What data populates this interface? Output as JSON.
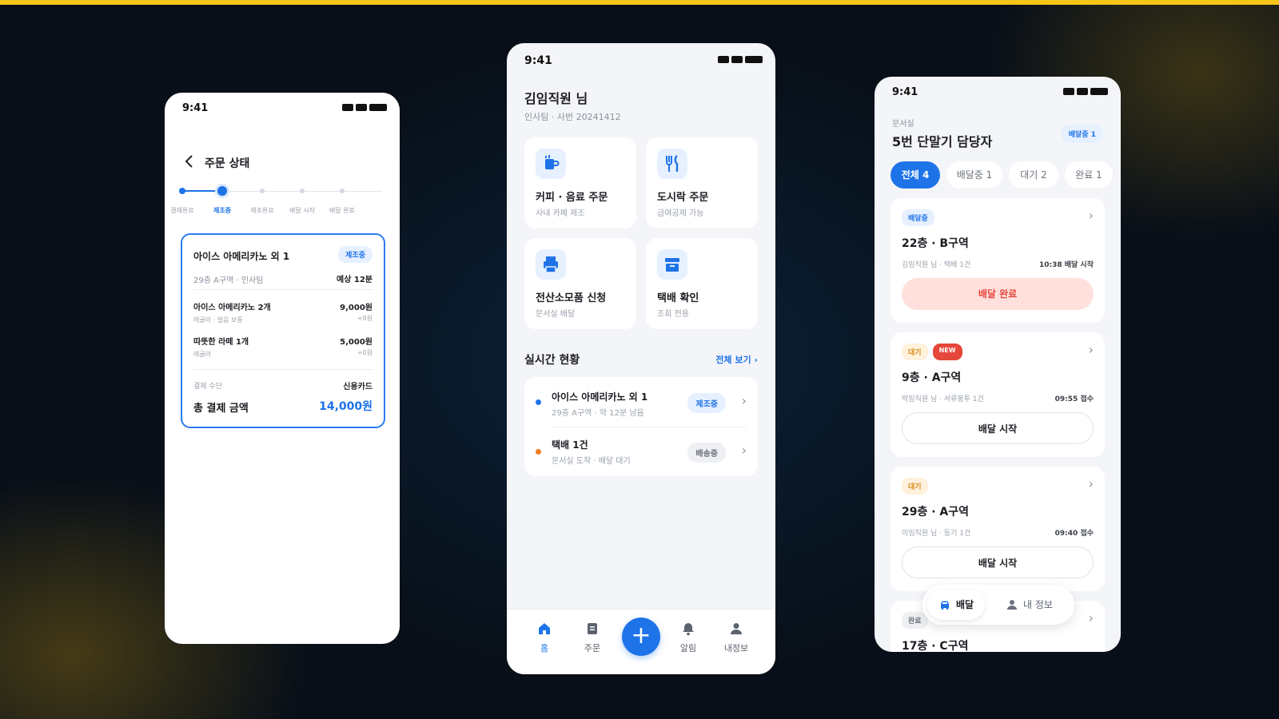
{
  "status": {
    "time": "9:41"
  },
  "order_status": {
    "title": "주문 상태",
    "steps": [
      "결제완료",
      "제조중",
      "제조완료",
      "배달 시작",
      "배달 완료"
    ],
    "current_step": 1,
    "order": {
      "title": "아이스 아메리카노 외 1",
      "badge": "제조중",
      "location": "29층 A구역 · 인사팀",
      "eta": "예상 12분",
      "items": [
        {
          "name": "아이스 아메리카노 2개",
          "options": "레귤러 · 얼음 보통",
          "price": "9,000원",
          "extra": "+0원"
        },
        {
          "name": "따뜻한 라떼 1개",
          "options": "레귤러",
          "price": "5,000원",
          "extra": "+0원"
        }
      ],
      "payment_label": "결제 수단",
      "payment_value": "신용카드",
      "total_label": "총 결제 금액",
      "total_value": "14,000원"
    }
  },
  "home": {
    "greeting": "김임직원 님",
    "sub": "인사팀 · 사번 20241412",
    "services": [
      {
        "title": "커피 · 음료 주문",
        "sub": "사내 카페 제조",
        "icon": "coffee-icon"
      },
      {
        "title": "도시락 주문",
        "sub": "급여공제 가능",
        "icon": "utensils-icon"
      },
      {
        "title": "전산소모품 신청",
        "sub": "문서실 배달",
        "icon": "printer-icon"
      },
      {
        "title": "택배 확인",
        "sub": "조회 전용",
        "icon": "box-icon"
      }
    ],
    "section_title": "실시간 현황",
    "section_link": "전체 보기 ›",
    "live": [
      {
        "title": "아이스 아메리카노 외 1",
        "sub": "29층 A구역 · 약 12분 남음",
        "badge": "제조중",
        "dot_color": "#1e73e8"
      },
      {
        "title": "택배 1건",
        "sub": "문서실 도착 · 배달 대기",
        "badge": "배송중",
        "dot_color": "#f07d22"
      }
    ],
    "tabs": [
      "홈",
      "주문",
      "알림",
      "내정보"
    ],
    "fab": "+"
  },
  "delivery": {
    "dept": "문서실",
    "manager": "5번 단말기 담당자",
    "badge": "배달중 1",
    "filters": [
      "전체 4",
      "배달중 1",
      "대기 2",
      "완료 1"
    ],
    "cards": [
      {
        "badges": [
          "배달중"
        ],
        "location": "22층 · B구역",
        "info": "김임직원 님 · 택배 1건",
        "time": "10:38 배달 시작",
        "button": "배달 완료"
      },
      {
        "badges": [
          "대기",
          "NEW"
        ],
        "location": "9층 · A구역",
        "info": "박임직원 님 · 서류봉투 1건",
        "time": "09:55 접수",
        "button": "배달 시작"
      },
      {
        "badges": [
          "대기"
        ],
        "location": "29층 · A구역",
        "info": "이임직원 님 · 등기 1건",
        "time": "09:40 접수",
        "button": "배달 시작"
      },
      {
        "badges": [
          "완료"
        ],
        "location": "17층 · C구역"
      }
    ],
    "nav": [
      "배달",
      "내 정보"
    ]
  },
  "colors": {
    "accent": "#1e73e8",
    "danger": "#e5473a",
    "warning": "#f07d22",
    "topbar": "#f5c518"
  }
}
